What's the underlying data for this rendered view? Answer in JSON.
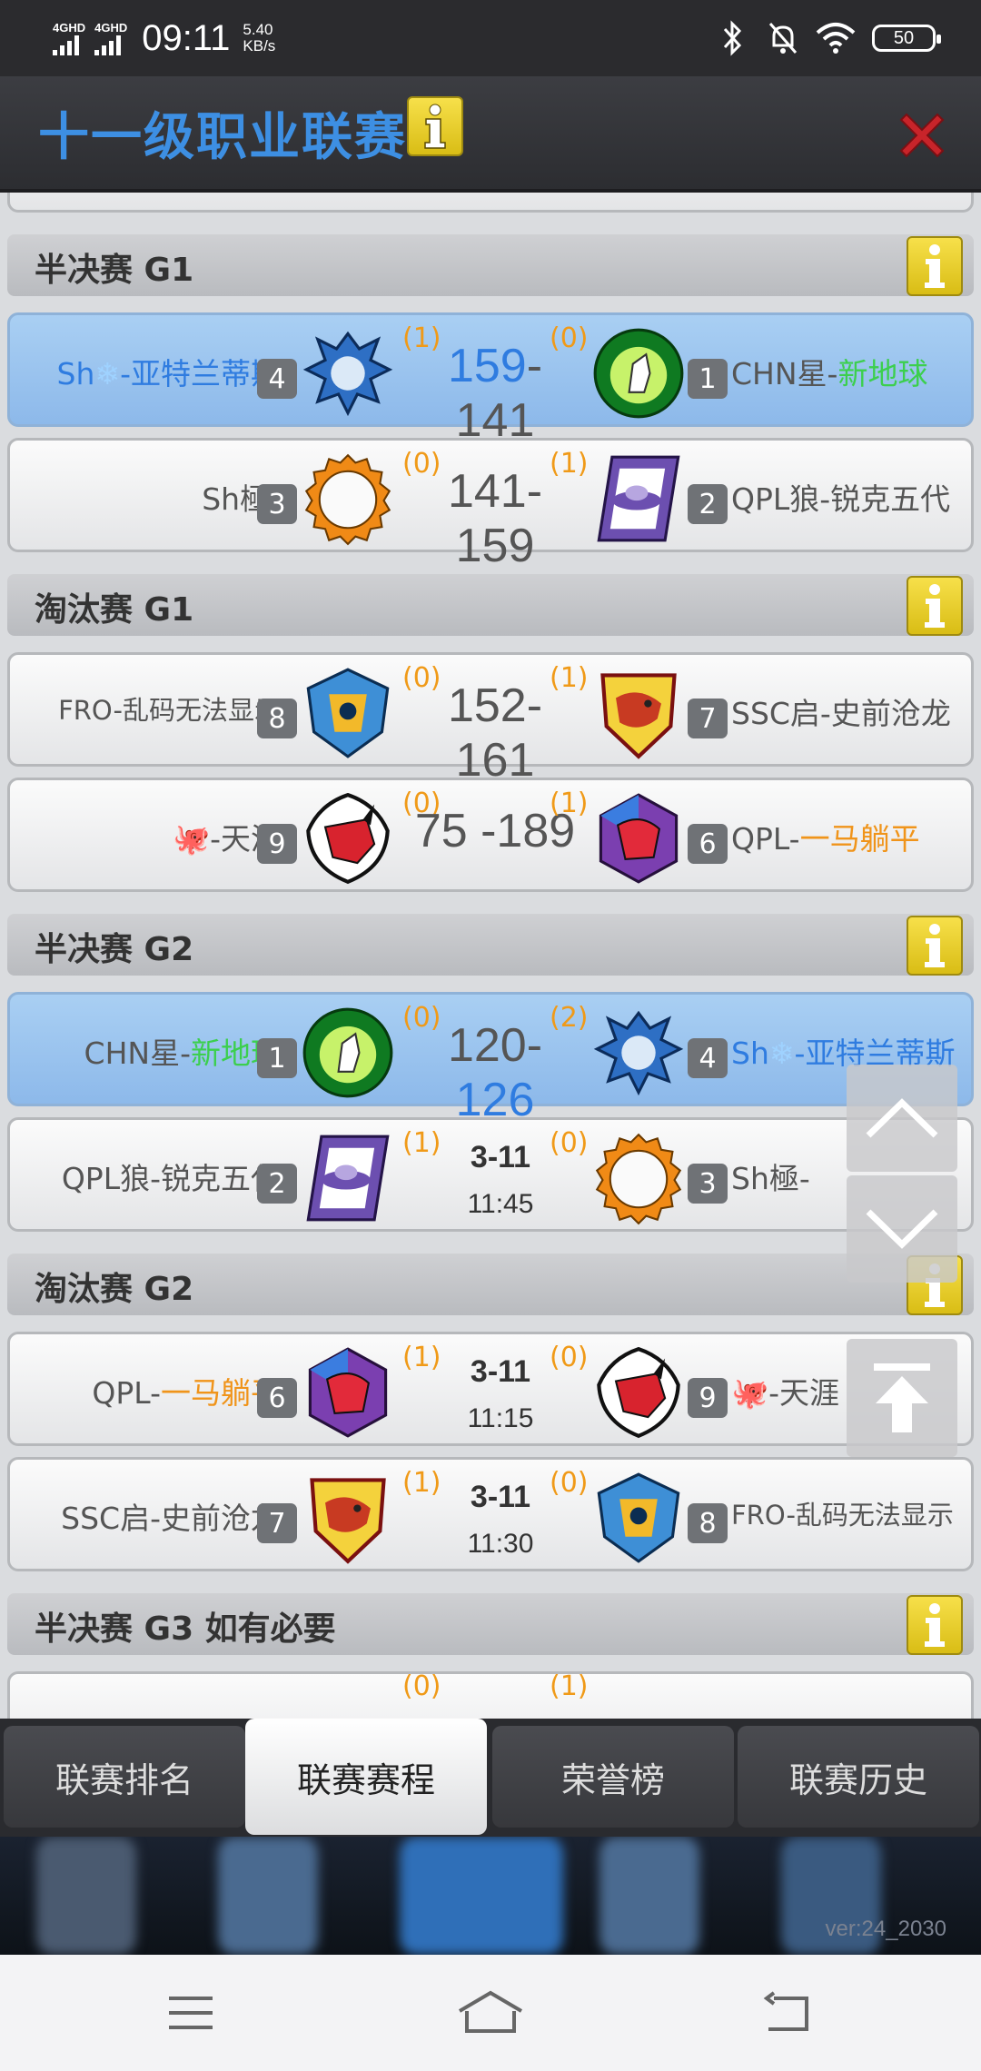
{
  "status_bar": {
    "net1": "4GHD",
    "net2": "4GHD",
    "time": "09:11",
    "speed_value": "5.40",
    "speed_unit": "KB/s",
    "battery": "50"
  },
  "header": {
    "title": "十一级职业联赛"
  },
  "sections": {
    "s1": "半决赛 G1",
    "s2": "淘汰赛 G1",
    "s3": "半决赛 G2",
    "s4": "淘汰赛 G2",
    "s5": "半决赛 G3 如有必要"
  },
  "matches": [
    {
      "left": {
        "prefix": "Sh",
        "emoji": "❄",
        "suffix": "-亚特兰蒂斯",
        "seed": "4",
        "wins": "(1)"
      },
      "right": {
        "prefix": "CHN星-",
        "suffix": "新地球",
        "seed": "1",
        "wins": "(0)"
      },
      "score_l": "159",
      "dash": "-",
      "score_r": "141"
    },
    {
      "left": {
        "name": "Sh極-",
        "seed": "3",
        "wins": "(0)"
      },
      "right": {
        "name": "QPL狼-锐克五代",
        "seed": "2",
        "wins": "(1)"
      },
      "score_l": "141",
      "dash": "-",
      "score_r": "159"
    },
    {
      "left": {
        "name": "FRO-乱码无法显示",
        "seed": "8",
        "wins": "(0)"
      },
      "right": {
        "name": "SSC启-史前沧龙",
        "seed": "7",
        "wins": "(1)"
      },
      "score_l": "152",
      "dash": "-",
      "score_r": "161"
    },
    {
      "left": {
        "suffix": "-天涯",
        "seed": "9",
        "wins": "(0)"
      },
      "right": {
        "prefix": "QPL-",
        "suffix": "一马躺平",
        "seed": "6",
        "wins": "(1)"
      },
      "score_l": "75",
      "dash": " -",
      "score_r": "189"
    },
    {
      "left": {
        "prefix": "CHN星-",
        "suffix": "新地球",
        "seed": "1",
        "wins": "(0)"
      },
      "right": {
        "prefix": "Sh",
        "emoji": "❄",
        "suffix": "-亚特兰蒂斯",
        "seed": "4",
        "wins": "(2)"
      },
      "score_l": "120",
      "dash": "-",
      "score_r": "126"
    },
    {
      "left": {
        "name": "QPL狼-锐克五代",
        "seed": "2",
        "wins": "(1)"
      },
      "right": {
        "name": "Sh極-",
        "seed": "3",
        "wins": "(0)"
      },
      "date": "3-11",
      "time": "11:45"
    },
    {
      "left": {
        "prefix": "QPL-",
        "suffix": "一马躺平",
        "seed": "6",
        "wins": "(1)"
      },
      "right": {
        "suffix": "-天涯",
        "seed": "9",
        "wins": "(0)"
      },
      "date": "3-11",
      "time": "11:15"
    },
    {
      "left": {
        "name": "SSC启-史前沧龙",
        "seed": "7",
        "wins": "(1)"
      },
      "right": {
        "name": "FRO-乱码无法显示",
        "seed": "8",
        "wins": "(0)"
      },
      "date": "3-11",
      "time": "11:30"
    },
    {
      "left": {
        "wins": "(0)"
      },
      "right": {
        "wins": "(1)"
      }
    }
  ],
  "tabs": [
    "联赛排名",
    "联赛赛程",
    "荣誉榜",
    "联赛历史"
  ],
  "active_tab": "联赛赛程",
  "version": "ver:24_2030",
  "colors": {
    "accent_blue": "#2f7ce0",
    "highlight_row": "#a9cff3",
    "green_text": "#3ccf4e",
    "orange_text": "#f0941a",
    "info_yellow": "#f2d42c",
    "close_red": "#d42a2a"
  }
}
